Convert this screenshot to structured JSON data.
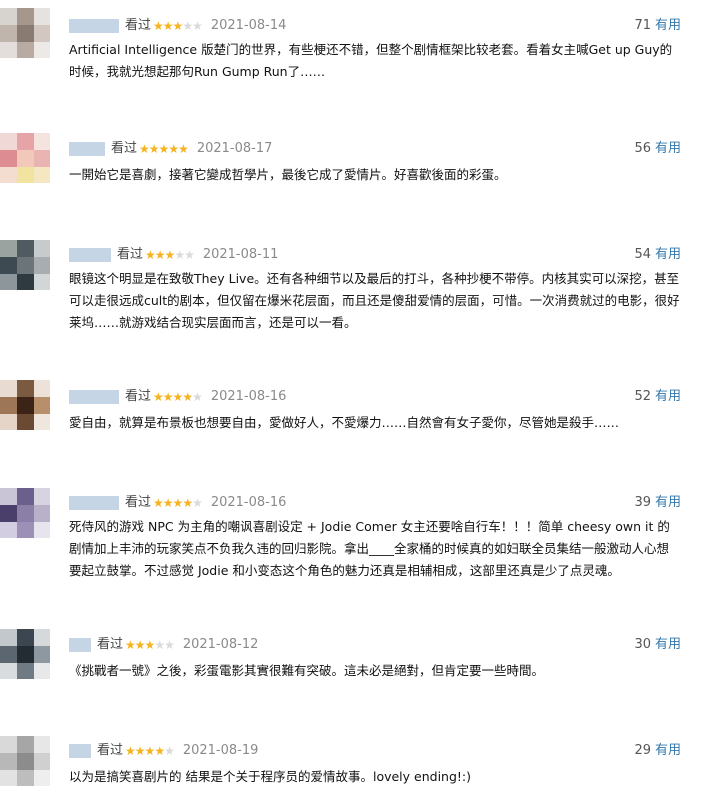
{
  "ui": {
    "seen_label": "看过",
    "useful_label": "有用"
  },
  "reviews": [
    {
      "rating": 3,
      "date": "2021-08-14",
      "votes": "71",
      "text": "Artificial Intelligence 版楚门的世界，有些梗还不错，但整个剧情框架比较老套。看着女主喊Get up Guy的时候，我就光想起那句Run Gump Run了……"
    },
    {
      "rating": 5,
      "date": "2021-08-17",
      "votes": "56",
      "text": "一開始它是喜劇，接著它變成哲學片，最後它成了愛情片。好喜歡後面的彩蛋。"
    },
    {
      "rating": 3,
      "date": "2021-08-11",
      "votes": "54",
      "text": "眼镜这个明显是在致敬They Live。还有各种细节以及最后的打斗，各种抄梗不带停。内核其实可以深挖，甚至可以走很远成cult的剧本，但仅留在爆米花层面，而且还是傻甜爱情的层面，可惜。一次消费就过的电影，很好莱坞……就游戏结合现实层面而言，还是可以一看。"
    },
    {
      "rating": 4,
      "date": "2021-08-16",
      "votes": "52",
      "text": "愛自由，就算是布景板也想要自由，愛做好人，不愛爆力……自然會有女子愛你，尽管她是殺手……"
    },
    {
      "rating": 4,
      "date": "2021-08-16",
      "votes": "39",
      "text": "死侍风的游戏 NPC 为主角的嘲讽喜剧设定 + Jodie Comer 女主还要啥自行车！！！简单 cheesy own it 的剧情加上丰沛的玩家笑点不负我久违的回归影院。拿出____全家桶的时候真的如妇联全员集结一般激动人心想要起立鼓掌。不过感觉 Jodie 和小变态这个角色的魅力还真是相辅相成，这部里还真是少了点灵魂。"
    },
    {
      "rating": 3,
      "date": "2021-08-12",
      "votes": "30",
      "text": "《挑戰者一號》之後，彩蛋電影其實很難有突破。這未必是絕對，但肯定要一些時間。"
    },
    {
      "rating": 4,
      "date": "2021-08-19",
      "votes": "29",
      "text": "以为是搞笑喜剧片的 结果是个关于程序员的爱情故事。lovely ending!:)"
    }
  ]
}
